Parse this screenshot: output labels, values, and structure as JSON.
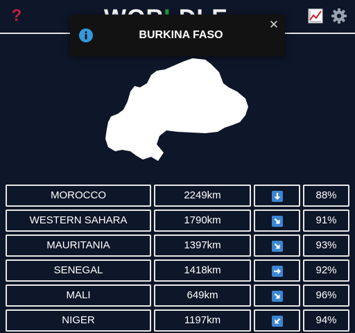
{
  "header": {
    "logo_part1": "WOR",
    "logo_part2": "L",
    "logo_part3": "DLE",
    "help_icon_glyph": "?",
    "colors": {
      "help": "#c02040",
      "logo_accent": "#1ea040",
      "background": "#0e1629"
    }
  },
  "toast": {
    "info_icon": "info-icon",
    "message": "BURKINA FASO",
    "close_glyph": "✕"
  },
  "map": {
    "icon": "country-silhouette"
  },
  "guesses": [
    {
      "country": "MOROCCO",
      "distance": "2249km",
      "direction": "down",
      "percent": "88%"
    },
    {
      "country": "WESTERN SAHARA",
      "distance": "1790km",
      "direction": "down-right",
      "percent": "91%"
    },
    {
      "country": "MAURITANIA",
      "distance": "1397km",
      "direction": "down-right",
      "percent": "93%"
    },
    {
      "country": "SENEGAL",
      "distance": "1418km",
      "direction": "right",
      "percent": "92%"
    },
    {
      "country": "MALI",
      "distance": "649km",
      "direction": "down-right",
      "percent": "96%"
    },
    {
      "country": "NIGER",
      "distance": "1197km",
      "direction": "down-left",
      "percent": "94%"
    }
  ]
}
